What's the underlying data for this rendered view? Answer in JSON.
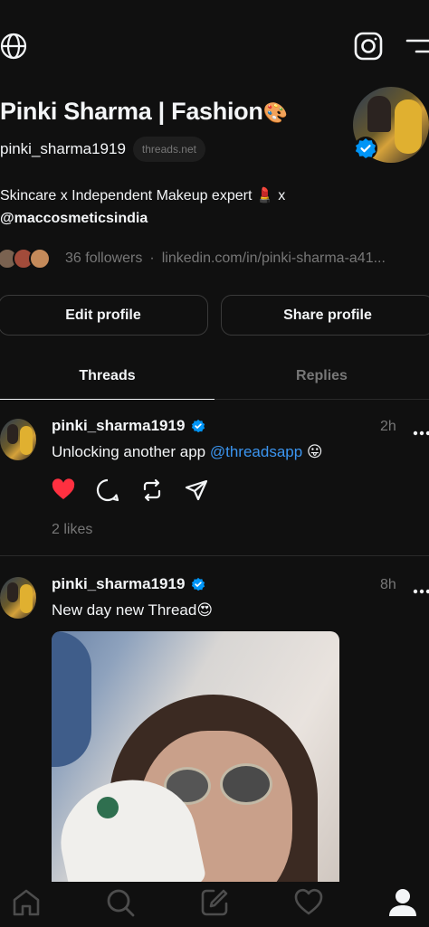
{
  "profile": {
    "name": "Pinki Sharma | Fashion",
    "name_emoji": "🎨",
    "handle": "pinki_sharma1919",
    "domain_chip": "threads.net",
    "bio_line1": "Skincare x Independent Makeup expert 💄 x",
    "bio_mention": "@maccosmeticsindia",
    "followers": "36 followers",
    "separator": "·",
    "link": "linkedin.com/in/pinki-sharma-a41...",
    "verified": true
  },
  "buttons": {
    "edit": "Edit profile",
    "share": "Share profile"
  },
  "tabs": [
    {
      "label": "Threads",
      "active": true
    },
    {
      "label": "Replies",
      "active": false
    }
  ],
  "posts": [
    {
      "username": "pinki_sharma1919",
      "time": "2h",
      "text": "Unlocking another app",
      "mention": "@threadsapp",
      "emoji": "😛",
      "liked": true,
      "likes": "2 likes"
    },
    {
      "username": "pinki_sharma1919",
      "time": "8h",
      "text": "New day new Thread",
      "emoji": "😍",
      "has_image": true
    }
  ],
  "colors": {
    "background": "#101010",
    "text": "#f3f5f7",
    "muted": "#777777",
    "link": "#3b95f0",
    "like": "#ff3040",
    "verified": "#0095f6"
  },
  "icons": {
    "top_left": "globe-icon",
    "top_right": [
      "instagram-icon",
      "menu-icon"
    ],
    "post_actions": [
      "heart-icon",
      "comment-icon",
      "repost-icon",
      "share-icon"
    ],
    "nav": [
      "home-icon",
      "search-icon",
      "compose-icon",
      "activity-heart-icon",
      "profile-icon"
    ]
  }
}
